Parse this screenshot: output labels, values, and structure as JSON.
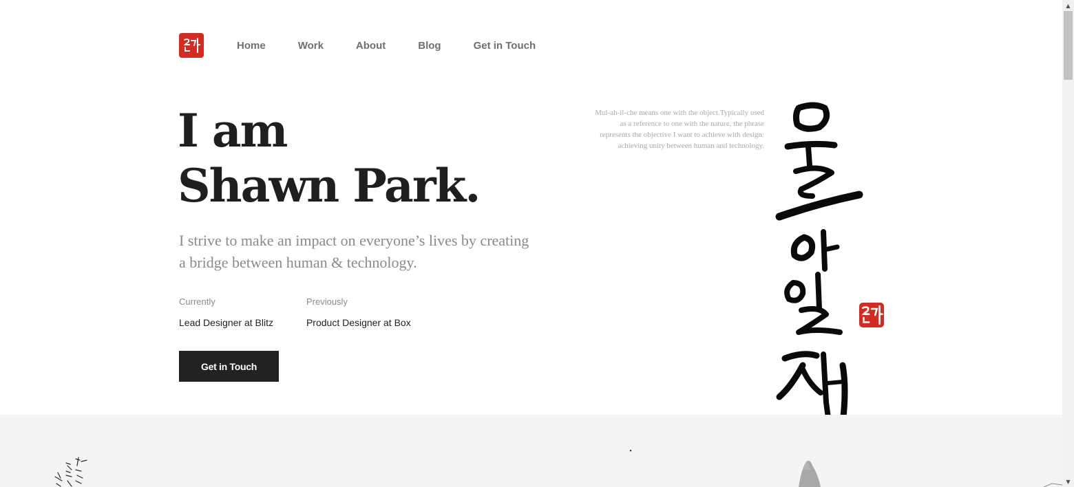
{
  "nav": {
    "logo_icon": "seal-logo-icon",
    "items": [
      {
        "label": "Home"
      },
      {
        "label": "Work"
      },
      {
        "label": "About"
      },
      {
        "label": "Blog"
      },
      {
        "label": "Get in Touch"
      }
    ]
  },
  "hero": {
    "title_line1": "I am",
    "title_line2": "Shawn Park.",
    "subtitle": "I strive to make an impact on everyone’s lives by creating a bridge between human & technology."
  },
  "roles": {
    "current_label": "Currently",
    "current_value": "Lead Designer at Blitz",
    "previous_label": "Previously",
    "previous_value": "Product Designer at Box"
  },
  "cta": {
    "label": "Get in Touch"
  },
  "calligraphy": {
    "caption": "Mul-ah-il-che means one with the object.Typically used as a reference to one with the nature, the phrase represents the objective I want to achieve with design: achieving unity between human and technology.",
    "text": "물아일체"
  },
  "colors": {
    "accent_red": "#d42a20",
    "text_dark": "#1f1f1f",
    "text_muted": "#8a8a8a",
    "button_bg": "#222222",
    "band_bg": "#f4f4f4"
  },
  "scrollbar": {
    "up_arrow": "▲",
    "down_arrow": "▼"
  }
}
